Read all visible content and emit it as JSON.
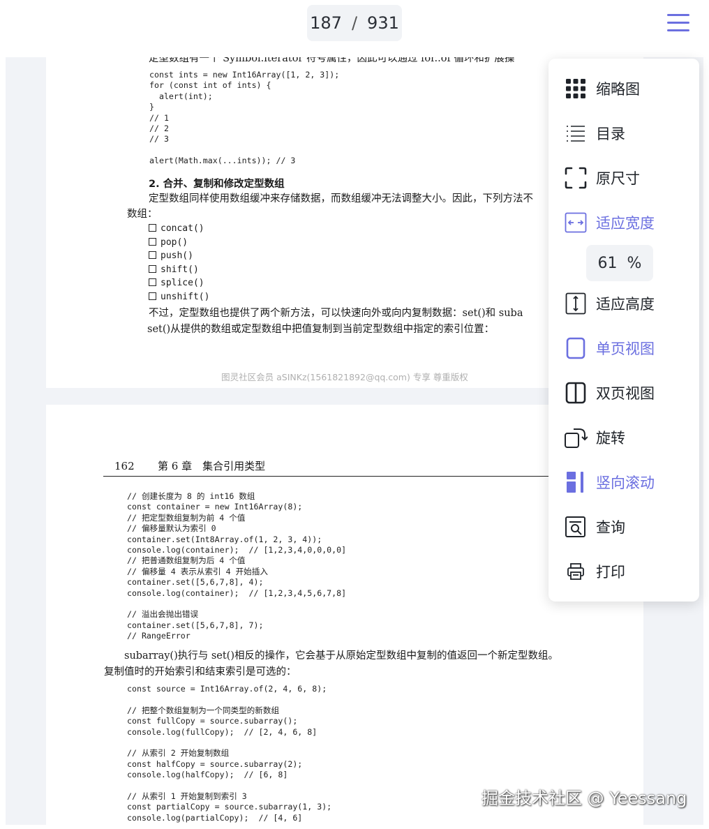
{
  "toolbar": {
    "current_page": "187",
    "separator": "/",
    "total_pages": "931",
    "menu_icon": "hamburger-menu-icon",
    "accent_color": "#6b6fe0"
  },
  "page1": {
    "intro": "定型数组有一个 Symbol.iterator 符号属性，因此可以通过 for..of 循环和扩展操",
    "code1": "const ints = new Int16Array([1, 2, 3]);\nfor (const int of ints) {\n  alert(int);\n}\n// 1\n// 2\n// 3\n\nalert(Math.max(...ints)); // 3",
    "heading": "2. 合并、复制和修改定型数组",
    "para1_line1": "定型数组同样使用数组缓冲来存储数据，而数组缓冲无法调整大小。因此，下列方法不",
    "para1_line2": "数组：",
    "methods": [
      "concat()",
      "pop()",
      "push()",
      "shift()",
      "splice()",
      "unshift()"
    ],
    "para2_line1": "不过，定型数组也提供了两个新方法，可以快速向外或向内复制数据：set()和 suba",
    "para2_line2": "set()从提供的数组或定型数组中把值复制到当前定型数组中指定的索引位置：",
    "footer": "图灵社区会员 aSINKz(1561821892@qq.com) 专享 尊重版权"
  },
  "page2": {
    "header_num": "162",
    "header_chapter": "第 6 章　集合引用类型",
    "code1": "// 创建长度为 8 的 int16 数组\nconst container = new Int16Array(8);\n// 把定型数组复制为前 4 个值\n// 偏移量默认为索引 0\ncontainer.set(Int8Array.of(1, 2, 3, 4));\nconsole.log(container);  // [1,2,3,4,0,0,0,0]\n// 把普通数组复制为后 4 个值\n// 偏移量 4 表示从索引 4 开始插入\ncontainer.set([5,6,7,8], 4);\nconsole.log(container);  // [1,2,3,4,5,6,7,8]\n\n// 溢出会抛出错误\ncontainer.set([5,6,7,8], 7);\n// RangeError",
    "para_line1": "subarray()执行与 set()相反的操作，它会基于从原始定型数组中复制的值返回一个新定型数组。",
    "para_line2": "复制值时的开始索引和结束索引是可选的：",
    "code2": "const source = Int16Array.of(2, 4, 6, 8);\n\n// 把整个数组复制为一个同类型的新数组\nconst fullCopy = source.subarray();\nconsole.log(fullCopy);  // [2, 4, 6, 8]\n\n// 从索引 2 开始复制数组\nconst halfCopy = source.subarray(2);\nconsole.log(halfCopy);  // [6, 8]\n\n// 从索引 1 开始复制到索引 3\nconst partialCopy = source.subarray(1, 3);\nconsole.log(partialCopy);  // [4, 6]"
  },
  "menu": {
    "items": [
      {
        "label": "缩略图",
        "icon": "grid-thumbnails-icon",
        "active": false
      },
      {
        "label": "目录",
        "icon": "list-outline-icon",
        "active": false
      },
      {
        "label": "原尺寸",
        "icon": "corners-actual-size-icon",
        "active": false
      },
      {
        "label": "适应宽度",
        "icon": "fit-width-icon",
        "active": true
      },
      {
        "label": "适应高度",
        "icon": "fit-height-icon",
        "active": false
      },
      {
        "label": "单页视图",
        "icon": "single-page-icon",
        "active": true
      },
      {
        "label": "双页视图",
        "icon": "double-page-icon",
        "active": false
      },
      {
        "label": "旋转",
        "icon": "rotate-icon",
        "active": false
      },
      {
        "label": "竖向滚动",
        "icon": "vertical-scroll-icon",
        "active": true
      },
      {
        "label": "查询",
        "icon": "search-document-icon",
        "active": false
      },
      {
        "label": "打印",
        "icon": "printer-icon",
        "active": false
      }
    ],
    "zoom_value": "61",
    "zoom_unit": "%"
  },
  "overlay_watermark": "掘金技术社区 @ Yeessang"
}
